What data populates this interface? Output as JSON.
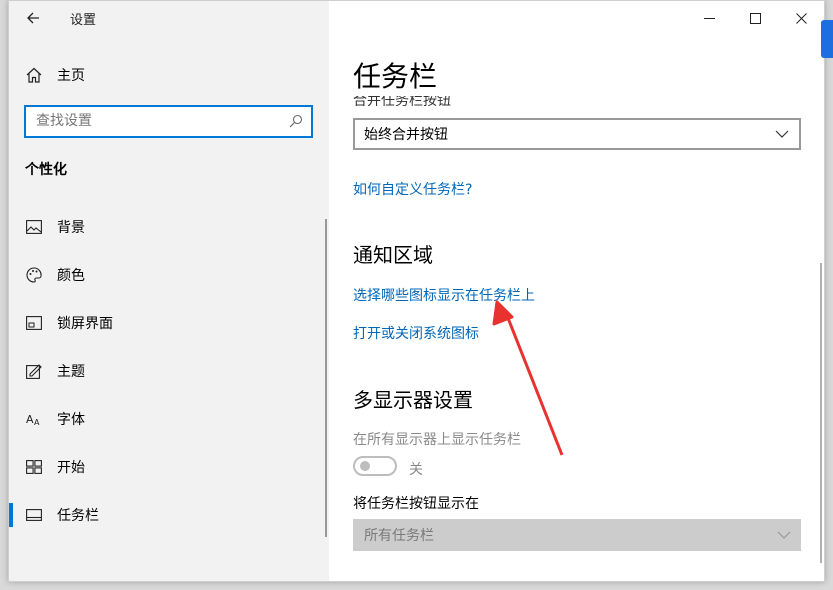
{
  "app": {
    "title": "设置"
  },
  "sidebar": {
    "home_label": "主页",
    "search_placeholder": "查找设置",
    "section_title": "个性化",
    "items": [
      {
        "label": "背景",
        "icon": "image-icon"
      },
      {
        "label": "颜色",
        "icon": "palette-icon"
      },
      {
        "label": "锁屏界面",
        "icon": "lock-screen-icon"
      },
      {
        "label": "主题",
        "icon": "theme-icon"
      },
      {
        "label": "字体",
        "icon": "font-icon"
      },
      {
        "label": "开始",
        "icon": "start-icon"
      },
      {
        "label": "任务栏",
        "icon": "taskbar-icon",
        "active": true
      }
    ]
  },
  "window_controls": {
    "minimize": "—",
    "maximize": "☐",
    "close": "✕"
  },
  "main": {
    "title": "任务栏",
    "combine_label": "合并任务栏按钮",
    "combine_value": "始终合并按钮",
    "customize_link": "如何自定义任务栏?",
    "notification_heading": "通知区域",
    "notification_link1": "选择哪些图标显示在任务栏上",
    "notification_link2": "打开或关闭系统图标",
    "multi_heading": "多显示器设置",
    "multi_show_label": "在所有显示器上显示任务栏",
    "multi_toggle_state": "关",
    "multi_buttons_label": "将任务栏按钮显示在",
    "multi_buttons_value": "所有任务栏"
  },
  "colors": {
    "accent": "#0078d7",
    "link": "#0067b8",
    "annotation": "#e8322f"
  }
}
